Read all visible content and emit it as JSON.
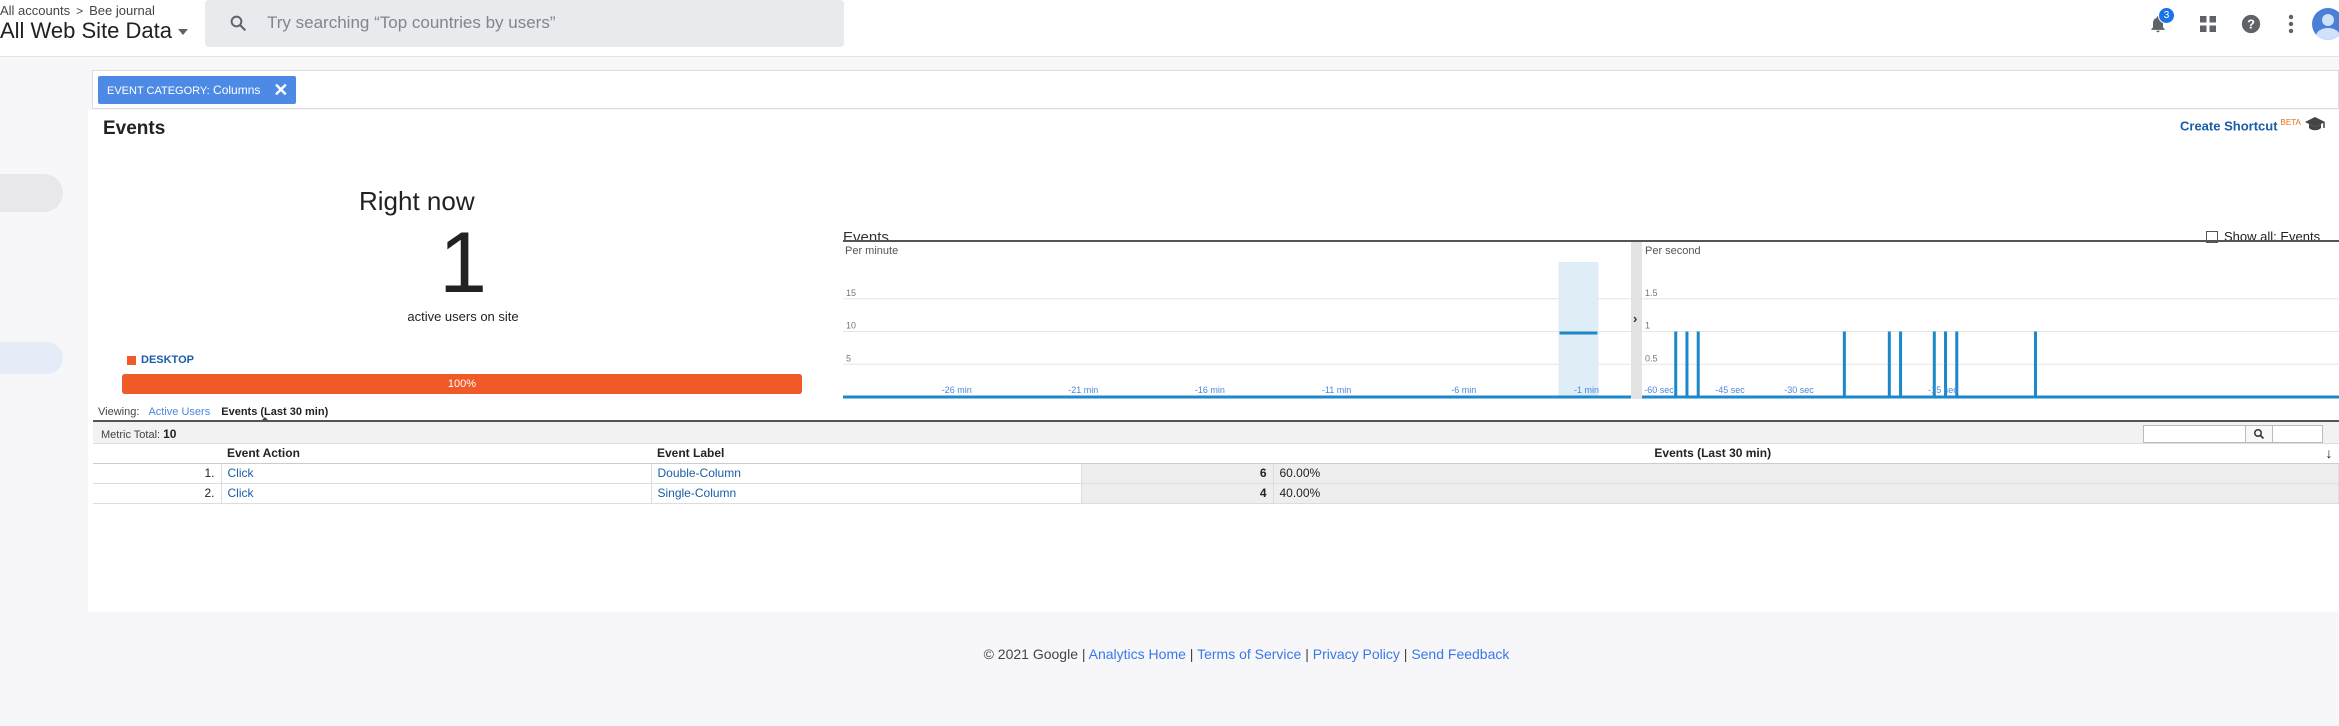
{
  "header": {
    "breadcrumb": [
      "All accounts",
      "Bee journal"
    ],
    "property": "All Web Site Data",
    "search_placeholder": "Try searching “Top countries by users”",
    "notification_count": "3"
  },
  "filter": {
    "key": "EVENT CATEGORY:",
    "value": "Columns"
  },
  "report": {
    "title": "Events",
    "create_shortcut": "Create Shortcut",
    "beta": "BETA"
  },
  "rightnow": {
    "label": "Right now",
    "value": "1",
    "sublabel": "active users on site",
    "device": {
      "name": "DESKTOP",
      "percent_label": "100%",
      "fraction": 1.0,
      "color": "#f05a28"
    }
  },
  "chart": {
    "title": "Events",
    "show_all": "Show all: Events",
    "per_minute_label": "Per minute",
    "per_second_label": "Per second"
  },
  "chart_data": [
    {
      "type": "bar",
      "title": "Per minute",
      "y_ticks": [
        "15",
        "10",
        "5"
      ],
      "ylim": [
        0,
        20
      ],
      "x_ticks": [
        "-26 min",
        "-21 min",
        "-16 min",
        "-11 min",
        "-6 min",
        "-1 min"
      ],
      "series": [
        {
          "values": [
            {
              "x": -2,
              "y": 10
            }
          ]
        }
      ],
      "highlight": {
        "x": -2
      },
      "color": "#1c87c9"
    },
    {
      "type": "bar",
      "title": "Per second",
      "y_ticks": [
        "1.5",
        "1",
        "0.5"
      ],
      "ylim": [
        0,
        2
      ],
      "x_ticks": [
        "-60 sec",
        "-45 sec",
        "-30 sec",
        "-15 sec"
      ],
      "series": [
        {
          "values": [
            {
              "x": -59,
              "y": 1
            },
            {
              "x": -58,
              "y": 1
            },
            {
              "x": -57,
              "y": 1
            },
            {
              "x": -44,
              "y": 1
            },
            {
              "x": -40,
              "y": 1
            },
            {
              "x": -39,
              "y": 1
            },
            {
              "x": -36,
              "y": 1
            },
            {
              "x": -35,
              "y": 1
            },
            {
              "x": -34,
              "y": 1
            },
            {
              "x": -27,
              "y": 1
            }
          ]
        }
      ],
      "color": "#1c87c9"
    }
  ],
  "viewing": {
    "label": "Viewing:",
    "option_active": "Active Users",
    "option_events": "Events (Last 30 min)"
  },
  "table": {
    "metric_label": "Metric Total:",
    "metric_total": "10",
    "columns": [
      "Event Action",
      "Event Label",
      "Events (Last 30 min)"
    ],
    "rows": [
      {
        "index": "1.",
        "action": "Click",
        "label": "Double-Column",
        "events": "6",
        "percent": "60.00%"
      },
      {
        "index": "2.",
        "action": "Click",
        "label": "Single-Column",
        "events": "4",
        "percent": "40.00%"
      }
    ]
  },
  "footer": {
    "copyright": "© 2021 Google",
    "links": [
      "Analytics Home",
      "Terms of Service",
      "Privacy Policy",
      "Send Feedback"
    ]
  }
}
